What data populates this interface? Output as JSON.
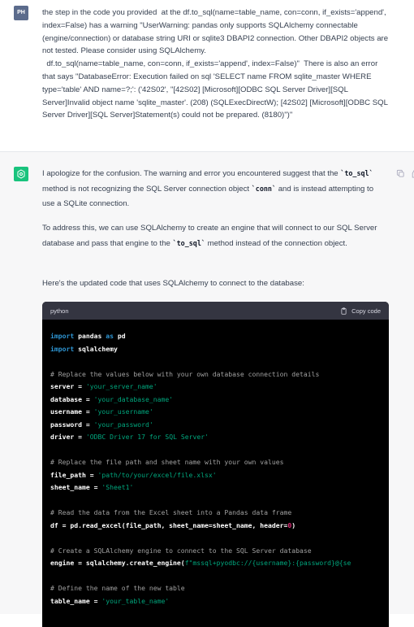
{
  "user": {
    "avatar_initials": "PH",
    "message": "the step in the code you provided  at the df.to_sql(name=table_name, con=conn, if_exists='append', index=False) has a warning \"UserWarning: pandas only supports SQLAlchemy connectable (engine/connection) or database string URI or sqlite3 DBAPI2 connection. Other DBAPI2 objects are not tested. Please consider using SQLAlchemy.\n  df.to_sql(name=table_name, con=conn, if_exists='append', index=False)\"  There is also an error that says \"DatabaseError: Execution failed on sql 'SELECT name FROM sqlite_master WHERE type='table' AND name=?;': ('42S02', \"[42S02] [Microsoft][ODBC SQL Server Driver][SQL Server]Invalid object name 'sqlite_master'. (208) (SQLExecDirectW); [42S02] [Microsoft][ODBC SQL Server Driver][SQL Server]Statement(s) could not be prepared. (8180)\")\""
  },
  "assistant": {
    "p1_a": "I apologize for the confusion. The warning and error you encountered suggest that the ",
    "p1_code1": "`to_sql`",
    "p1_b": " method is not recognizing the SQL Server connection object ",
    "p1_code2": "`conn`",
    "p1_c": " and is instead attempting to use a SQLite connection.",
    "p2_a": "To address this, we can use SQLAlchemy to create an engine that will connect to our SQL Server database and pass that engine to the ",
    "p2_code": "`to_sql`",
    "p2_b": " method instead of the connection object.",
    "p3": "Here's the updated code that uses SQLAlchemy to connect to the database:",
    "code_lang": "python",
    "copy_label": "Copy code",
    "code": {
      "l1_kw": "import",
      "l1_rest": " pandas ",
      "l1_as": "as",
      "l1_alias": " pd",
      "l2_kw": "import",
      "l2_rest": " sqlalchemy",
      "c1": "# Replace the values below with your own database connection details",
      "v_server": "server",
      "s_server": "'your_server_name'",
      "v_database": "database",
      "s_database": "'your_database_name'",
      "v_username": "username",
      "s_username": "'your_username'",
      "v_password": "password",
      "s_password": "'your_password'",
      "v_driver": "driver",
      "s_driver": "'ODBC Driver 17 for SQL Server'",
      "c2": "# Replace the file path and sheet name with your own values",
      "v_file": "file_path",
      "s_file": "'path/to/your/excel/file.xlsx'",
      "v_sheet": "sheet_name",
      "s_sheet": "'Sheet1'",
      "c3": "# Read the data from the Excel sheet into a Pandas data frame",
      "l_df": "df = pd.read_excel(file_path, sheet_name=sheet_name, header=",
      "l_df_num": "0",
      "l_df_end": ")",
      "c4": "# Create a SQLAlchemy engine to connect to the SQL Server database",
      "l_engine": "engine = sqlalchemy.create_engine(",
      "l_engine_str": "f\"mssql+pyodbc://{username}:{password}@{se",
      "c5": "# Define the name of the new table",
      "v_table": "table_name",
      "s_table": "'your_table_name'",
      "eq": " = "
    }
  }
}
